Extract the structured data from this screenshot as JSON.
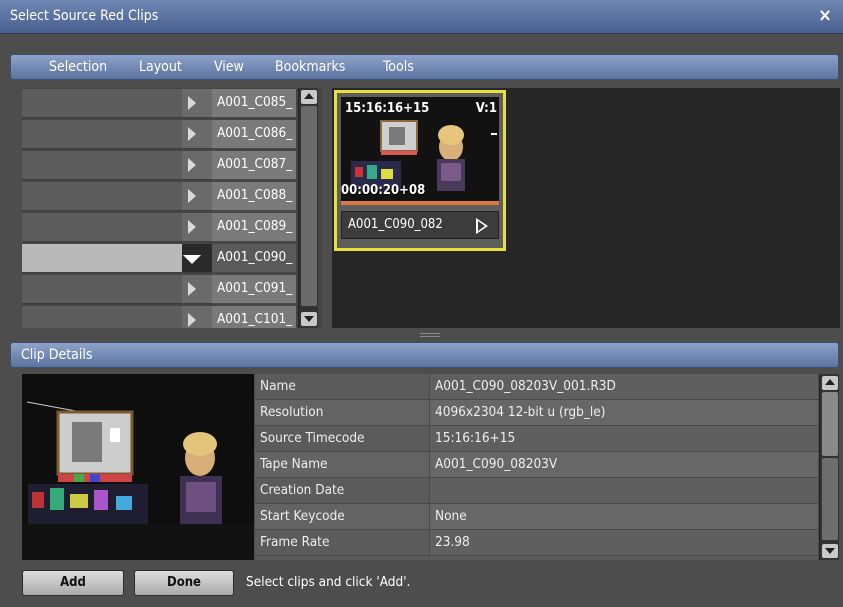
{
  "window": {
    "title": "Select Source Red Clips",
    "close_glyph": "×"
  },
  "menu": [
    "Selection",
    "Layout",
    "View",
    "Bookmarks",
    "Tools"
  ],
  "clip_list": [
    {
      "name": "A001_C085_",
      "expanded": false
    },
    {
      "name": "A001_C086_",
      "expanded": false
    },
    {
      "name": "A001_C087_",
      "expanded": false
    },
    {
      "name": "A001_C088_",
      "expanded": false
    },
    {
      "name": "A001_C089_",
      "expanded": false
    },
    {
      "name": "A001_C090_",
      "expanded": true
    },
    {
      "name": "A001_C091_",
      "expanded": false
    },
    {
      "name": "A001_C101_",
      "expanded": false
    }
  ],
  "tile": {
    "timecode_top": "15:16:16+15",
    "version": "V:1",
    "timecode_bottom": "00:00:20+08",
    "label": "A001_C090_082",
    "highlight_color": "#e7df3c"
  },
  "details": {
    "header": "Clip Details",
    "rows": [
      {
        "key": "Name",
        "value": "A001_C090_08203V_001.R3D"
      },
      {
        "key": "Resolution",
        "value": "4096x2304 12-bit u (rgb_le)"
      },
      {
        "key": "Source Timecode",
        "value": "15:16:16+15"
      },
      {
        "key": "Tape Name",
        "value": "A001_C090_08203V"
      },
      {
        "key": "Creation Date",
        "value": ""
      },
      {
        "key": "Start Keycode",
        "value": "None"
      },
      {
        "key": "Frame Rate",
        "value": "23.98"
      }
    ]
  },
  "footer": {
    "add_label": "Add",
    "done_label": "Done",
    "status": "Select clips and click 'Add'."
  }
}
